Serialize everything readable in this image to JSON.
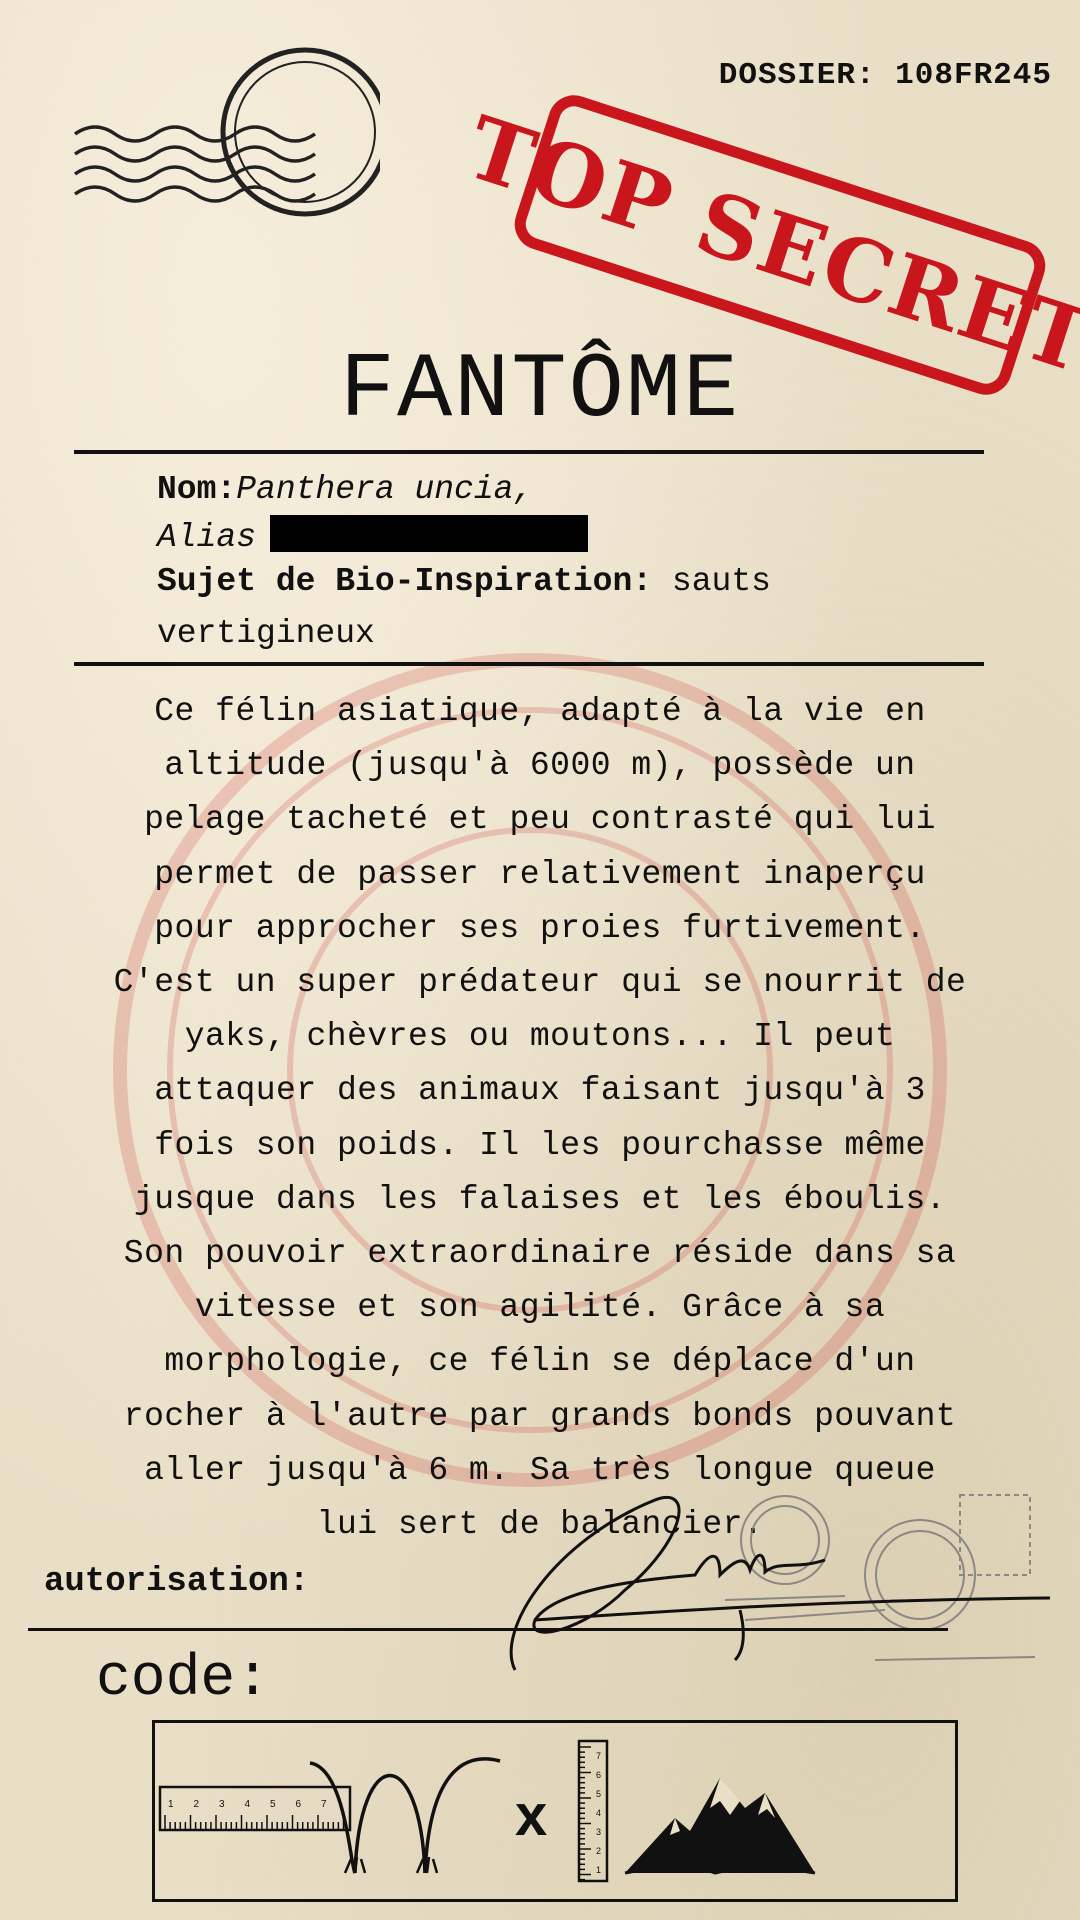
{
  "dossier": "DOSSIER: 108FR245",
  "stamp": "TOP SECRET",
  "title": "FANTÔME",
  "identity": {
    "nom_label": "Nom:",
    "nom_value": "Panthera uncia,",
    "alias_label": "Alias",
    "sujet_label": "Sujet de Bio-Inspiration:",
    "sujet_value_1": "sauts",
    "sujet_value_2": "vertigineux"
  },
  "body_lines": [
    "Ce félin asiatique, adapté à la vie en",
    "altitude (jusqu'à 6000 m), possède un",
    "pelage tacheté et peu contrasté qui lui",
    "permet de passer relativement inaperçu",
    "pour approcher ses proies furtivement.",
    "C'est un super prédateur qui se nourrit de",
    "yaks, chèvres ou moutons... Il peut",
    "attaquer des animaux faisant jusqu'à 3",
    "fois son poids. Il les pourchasse même",
    "jusque dans les falaises et les éboulis.",
    "Son pouvoir extraordinaire réside dans sa",
    "vitesse et son agilité. Grâce à sa",
    "morphologie, ce félin se déplace d'un",
    "rocher à l'autre par grands bonds pouvant",
    "aller jusqu'à 6 m. Sa très longue queue",
    "lui sert de balancier."
  ],
  "autorisation_label": "autorisation:",
  "code_label": "code:",
  "code": {
    "ruler_h_ticks": [
      "1",
      "2",
      "3",
      "4",
      "5",
      "6",
      "7"
    ],
    "operator": "x",
    "ruler_v_ticks": [
      "1",
      "2",
      "3",
      "4",
      "5",
      "6",
      "7"
    ]
  },
  "colors": {
    "paper": "#e9dfc7",
    "ink": "#111111",
    "stamp_red": "#c8161c"
  }
}
